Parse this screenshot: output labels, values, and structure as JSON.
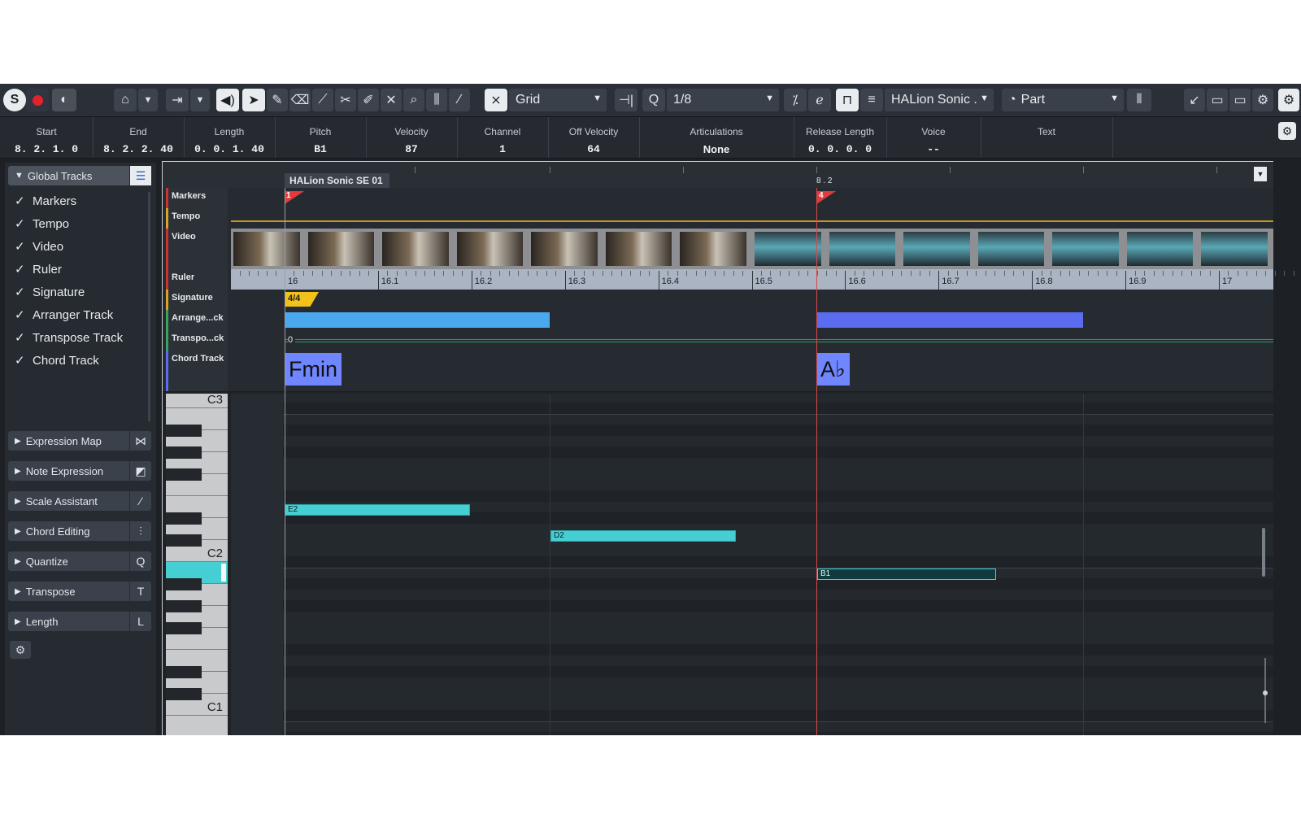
{
  "toolbar": {
    "snap_mode": "Grid",
    "quantize": "1/8",
    "instrument": "HALion Sonic .",
    "part_mode": "Part"
  },
  "infoline": [
    {
      "label": "Start",
      "value": "8. 2. 1.   0"
    },
    {
      "label": "End",
      "value": "8. 2. 2. 40"
    },
    {
      "label": "Length",
      "value": "0. 0. 1. 40"
    },
    {
      "label": "Pitch",
      "value": "B1"
    },
    {
      "label": "Velocity",
      "value": "87"
    },
    {
      "label": "Channel",
      "value": "1"
    },
    {
      "label": "Off Velocity",
      "value": "64"
    },
    {
      "label": "Articulations",
      "value": "None"
    },
    {
      "label": "Release Length",
      "value": "0. 0. 0.   0"
    },
    {
      "label": "Voice",
      "value": "--"
    },
    {
      "label": "Text",
      "value": ""
    }
  ],
  "global_tracks": {
    "title": "Global Tracks",
    "items": [
      "Markers",
      "Tempo",
      "Video",
      "Ruler",
      "Signature",
      "Arranger Track",
      "Transpose Track",
      "Chord Track"
    ]
  },
  "sections": [
    "Expression Map",
    "Note Expression",
    "Scale Assistant",
    "Chord Editing",
    "Quantize",
    "Transpose",
    "Length"
  ],
  "editor": {
    "part_name": "HALion Sonic SE 01",
    "position_label": "8 . 2",
    "lanes": {
      "markers": "Markers",
      "tempo": "Tempo",
      "video": "Video",
      "ruler": "Ruler",
      "signature": "Signature",
      "arranger": "Arrange...ck",
      "transpose": "Transpo...ck",
      "chord": "Chord Track"
    },
    "marker1": "1",
    "marker2": "4",
    "signature_value": "4/4",
    "transpose_value": "0",
    "chord1": "Fmin",
    "chord2": "A♭",
    "ruler_ticks": [
      "16",
      "16.1",
      "16.2",
      "16.3",
      "16.4",
      "16.5",
      "16.6",
      "16.7",
      "16.8",
      "16.9",
      "17"
    ],
    "keys": [
      "C3",
      "C2",
      "C1"
    ],
    "notes": [
      "E2",
      "D2",
      "B1"
    ]
  },
  "colors": {
    "note": "#46cfd3",
    "selected_note": "#0f3b3e",
    "arranger": "#4aa8ee",
    "arranger2": "#5c6cf0",
    "chord": "#6f86ff",
    "marker": "#e23b3b",
    "signature": "#f2c21b"
  }
}
